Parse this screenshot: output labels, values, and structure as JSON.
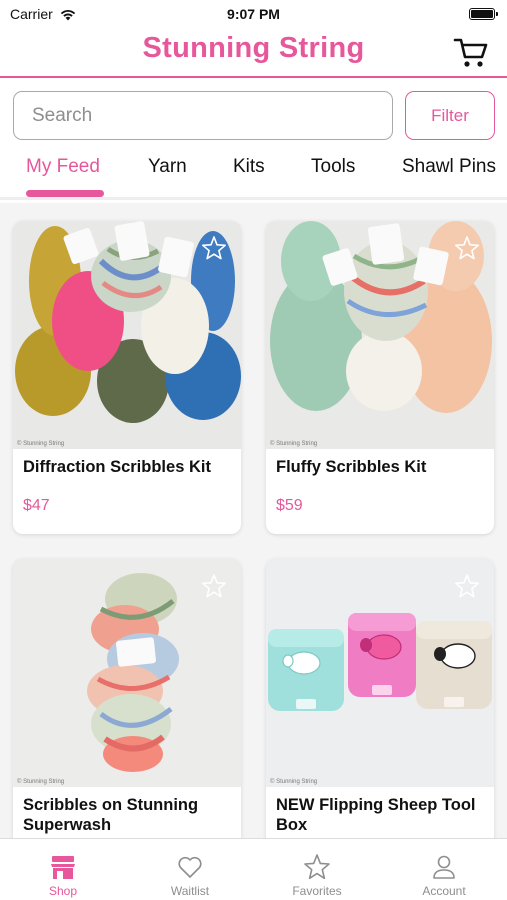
{
  "status_bar": {
    "carrier": "Carrier",
    "time": "9:07 PM"
  },
  "header": {
    "title": "Stunning String"
  },
  "search": {
    "placeholder": "Search",
    "value": ""
  },
  "filter_label": "Filter",
  "tabs": [
    {
      "label": "My Feed",
      "active": true
    },
    {
      "label": "Yarn",
      "active": false
    },
    {
      "label": "Kits",
      "active": false
    },
    {
      "label": "Tools",
      "active": false
    },
    {
      "label": "Shawl Pins",
      "active": false
    }
  ],
  "products": [
    {
      "title": "Diffraction Scribbles Kit",
      "price": "$47",
      "watermark": "© Stunning String"
    },
    {
      "title": "Fluffy Scribbles Kit",
      "price": "$59",
      "watermark": "© Stunning String"
    },
    {
      "title": "Scribbles on Stunning Superwash",
      "price": "",
      "watermark": "© Stunning String"
    },
    {
      "title": "NEW Flipping Sheep Tool Box",
      "price": "",
      "watermark": "© Stunning String"
    }
  ],
  "tabbar": [
    {
      "label": "Shop",
      "icon": "shop-icon",
      "active": true
    },
    {
      "label": "Waitlist",
      "icon": "heart-icon",
      "active": false
    },
    {
      "label": "Favorites",
      "icon": "star-icon",
      "active": false
    },
    {
      "label": "Account",
      "icon": "account-icon",
      "active": false
    }
  ],
  "colors": {
    "accent": "#e6579b",
    "inactive": "#8e8e8e",
    "background": "#f4f4f4"
  }
}
